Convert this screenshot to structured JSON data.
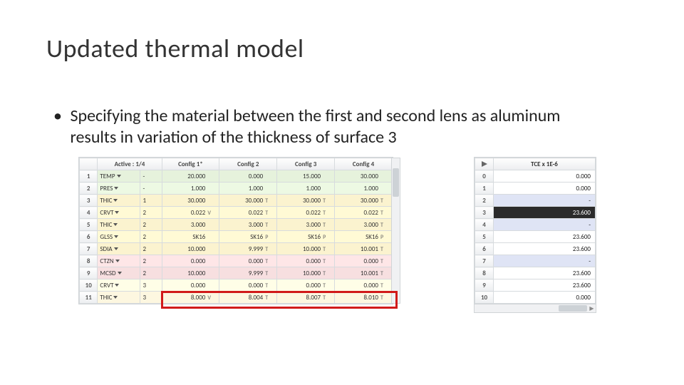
{
  "title": "Updated thermal model",
  "bullet": "Specifying the material between the first and second lens as aluminum results in variation of the thickness of surface 3",
  "mc": {
    "header_active": "Active : 1/4",
    "configs": [
      "Config 1*",
      "Config 2",
      "Config 3",
      "Config 4"
    ],
    "rows": [
      {
        "n": "1",
        "op": "TEMP",
        "surf": "-",
        "band": "green",
        "vals": [
          {
            "v": "20.000",
            "f": ""
          },
          {
            "v": "0.000",
            "f": ""
          },
          {
            "v": "15.000",
            "f": ""
          },
          {
            "v": "30.000",
            "f": ""
          }
        ]
      },
      {
        "n": "2",
        "op": "PRES",
        "surf": "-",
        "band": "green",
        "vals": [
          {
            "v": "1.000",
            "f": ""
          },
          {
            "v": "1.000",
            "f": ""
          },
          {
            "v": "1.000",
            "f": ""
          },
          {
            "v": "1.000",
            "f": ""
          }
        ]
      },
      {
        "n": "3",
        "op": "THIC",
        "surf": "1",
        "band": "yellow",
        "vals": [
          {
            "v": "30.000",
            "f": ""
          },
          {
            "v": "30.000",
            "f": "T"
          },
          {
            "v": "30.000",
            "f": "T"
          },
          {
            "v": "30.000",
            "f": "T"
          }
        ]
      },
      {
        "n": "4",
        "op": "CRVT",
        "surf": "2",
        "band": "yellow",
        "vals": [
          {
            "v": "0.022",
            "f": "V"
          },
          {
            "v": "0.022",
            "f": "T"
          },
          {
            "v": "0.022",
            "f": "T"
          },
          {
            "v": "0.022",
            "f": "T"
          }
        ]
      },
      {
        "n": "5",
        "op": "THIC",
        "surf": "2",
        "band": "yellow",
        "vals": [
          {
            "v": "3.000",
            "f": ""
          },
          {
            "v": "3.000",
            "f": "T"
          },
          {
            "v": "3.000",
            "f": "T"
          },
          {
            "v": "3.000",
            "f": "T"
          }
        ]
      },
      {
        "n": "6",
        "op": "GLSS",
        "surf": "2",
        "band": "yellow",
        "vals": [
          {
            "v": "SK16",
            "f": ""
          },
          {
            "v": "SK16",
            "f": "P"
          },
          {
            "v": "SK16",
            "f": "P"
          },
          {
            "v": "SK16",
            "f": "P"
          }
        ]
      },
      {
        "n": "7",
        "op": "SDIA",
        "surf": "2",
        "band": "yellow",
        "vals": [
          {
            "v": "10.000",
            "f": ""
          },
          {
            "v": "9.999",
            "f": "T"
          },
          {
            "v": "10.000",
            "f": "T"
          },
          {
            "v": "10.001",
            "f": "T"
          }
        ]
      },
      {
        "n": "8",
        "op": "CTZN",
        "surf": "2",
        "band": "pink",
        "vals": [
          {
            "v": "0.000",
            "f": ""
          },
          {
            "v": "0.000",
            "f": "T"
          },
          {
            "v": "0.000",
            "f": "T"
          },
          {
            "v": "0.000",
            "f": "T"
          }
        ]
      },
      {
        "n": "9",
        "op": "MCSD",
        "surf": "2",
        "band": "pink",
        "vals": [
          {
            "v": "10.000",
            "f": ""
          },
          {
            "v": "9.999",
            "f": "T"
          },
          {
            "v": "10.000",
            "f": "T"
          },
          {
            "v": "10.001",
            "f": "T"
          }
        ]
      },
      {
        "n": "10",
        "op": "CRVT",
        "surf": "3",
        "band": "cream",
        "vals": [
          {
            "v": "0.000",
            "f": ""
          },
          {
            "v": "0.000",
            "f": "T"
          },
          {
            "v": "0.000",
            "f": "T"
          },
          {
            "v": "0.000",
            "f": "T"
          }
        ]
      },
      {
        "n": "11",
        "op": "THIC",
        "surf": "3",
        "band": "cream",
        "vals": [
          {
            "v": "8.000",
            "f": "V"
          },
          {
            "v": "8.004",
            "f": "T"
          },
          {
            "v": "8.007",
            "f": "T"
          },
          {
            "v": "8.010",
            "f": "T"
          }
        ]
      }
    ],
    "highlight_row": "11"
  },
  "tce": {
    "header": "TCE x 1E-6",
    "rows": [
      {
        "n": "0",
        "v": "0.000",
        "style": ""
      },
      {
        "n": "1",
        "v": "0.000",
        "style": ""
      },
      {
        "n": "2",
        "v": "-",
        "style": "blue"
      },
      {
        "n": "3",
        "v": "23.600",
        "style": "sel"
      },
      {
        "n": "4",
        "v": "-",
        "style": "blue"
      },
      {
        "n": "5",
        "v": "23.600",
        "style": ""
      },
      {
        "n": "6",
        "v": "23.600",
        "style": ""
      },
      {
        "n": "7",
        "v": "-",
        "style": "blue"
      },
      {
        "n": "8",
        "v": "23.600",
        "style": ""
      },
      {
        "n": "9",
        "v": "23.600",
        "style": ""
      },
      {
        "n": "10",
        "v": "0.000",
        "style": ""
      }
    ]
  }
}
